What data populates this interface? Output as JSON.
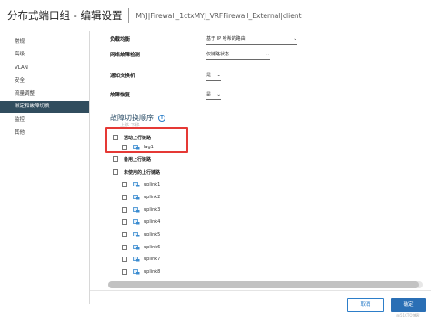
{
  "header": {
    "title": "分布式端口组 - 编辑设置",
    "subtitle": "MYJ|Firewall_1ctxMYJ_VRFFirewall_External|client"
  },
  "sidebar": {
    "items": [
      {
        "label": "常规",
        "active": false
      },
      {
        "label": "高级",
        "active": false
      },
      {
        "label": "VLAN",
        "active": false
      },
      {
        "label": "安全",
        "active": false
      },
      {
        "label": "流量调整",
        "active": false
      },
      {
        "label": "绑定和故障切换",
        "active": true
      },
      {
        "label": "监控",
        "active": false
      },
      {
        "label": "其他",
        "active": false
      }
    ]
  },
  "form": {
    "load_balancing": {
      "label": "负载均衡",
      "value": "基于 IP 哈希的路由"
    },
    "failure_detection": {
      "label": "网络故障检测",
      "value": "仅链路状态"
    },
    "notify_switches": {
      "label": "通知交换机",
      "value": "是"
    },
    "failback": {
      "label": "故障恢复",
      "value": "是"
    }
  },
  "failover": {
    "title": "故障切换顺序",
    "hint": "上移   下移",
    "active_group": {
      "label": "活动上行链路",
      "children": [
        "lag1"
      ]
    },
    "standby_group": {
      "label": "备用上行链路"
    },
    "unused_group": {
      "label": "未使用的上行链路",
      "children": [
        "uplink1",
        "uplink2",
        "uplink3",
        "uplink4",
        "uplink5",
        "uplink6",
        "uplink7",
        "uplink8"
      ]
    }
  },
  "footer": {
    "cancel_label": "取消",
    "ok_label": "确定",
    "watermark": "@51CTO博客"
  },
  "colors": {
    "active_sidebar": "#314d5e",
    "primary": "#2a6fb5",
    "highlight": "#e53935",
    "link_icon": "#3a8bd0"
  }
}
